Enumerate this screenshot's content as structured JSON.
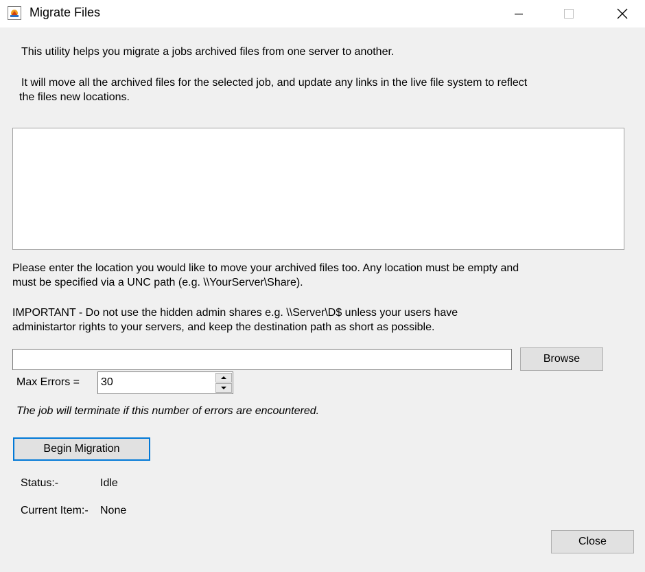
{
  "window": {
    "title": "Migrate Files",
    "icons": {
      "app": "migrate-app-icon",
      "minimize": "minimize-icon",
      "maximize": "maximize-icon",
      "close": "close-icon"
    }
  },
  "intro": {
    "line1": "This utility helps you migrate a jobs archived files from one server to another.",
    "line2a": "It will move all the archived files for the selected job, and update any links in the live file system to reflect",
    "line2b": "the files new locations."
  },
  "location_help": {
    "line1": "Please enter the location you would like to move your archived files too. Any location must be empty and",
    "line2": "must be specified via a UNC path (e.g. \\\\YourServer\\Share)."
  },
  "important": {
    "line1": "IMPORTANT - Do not use the hidden admin shares e.g. \\\\Server\\D$ unless your users have",
    "line2": "administartor rights to your servers, and keep the destination path as short as possible."
  },
  "destination": {
    "value": "",
    "placeholder": ""
  },
  "buttons": {
    "browse": "Browse",
    "begin_migration": "Begin Migration",
    "close": "Close"
  },
  "max_errors": {
    "label": "Max Errors =",
    "value": "30",
    "note": "The job will terminate if this number of errors are encountered."
  },
  "status": {
    "label": "Status:-",
    "value": "Idle",
    "current_item_label": "Current Item:-",
    "current_item_value": "None"
  },
  "colors": {
    "focus_border": "#0078d7",
    "background": "#f0f0f0",
    "titlebar": "#ffffff"
  }
}
